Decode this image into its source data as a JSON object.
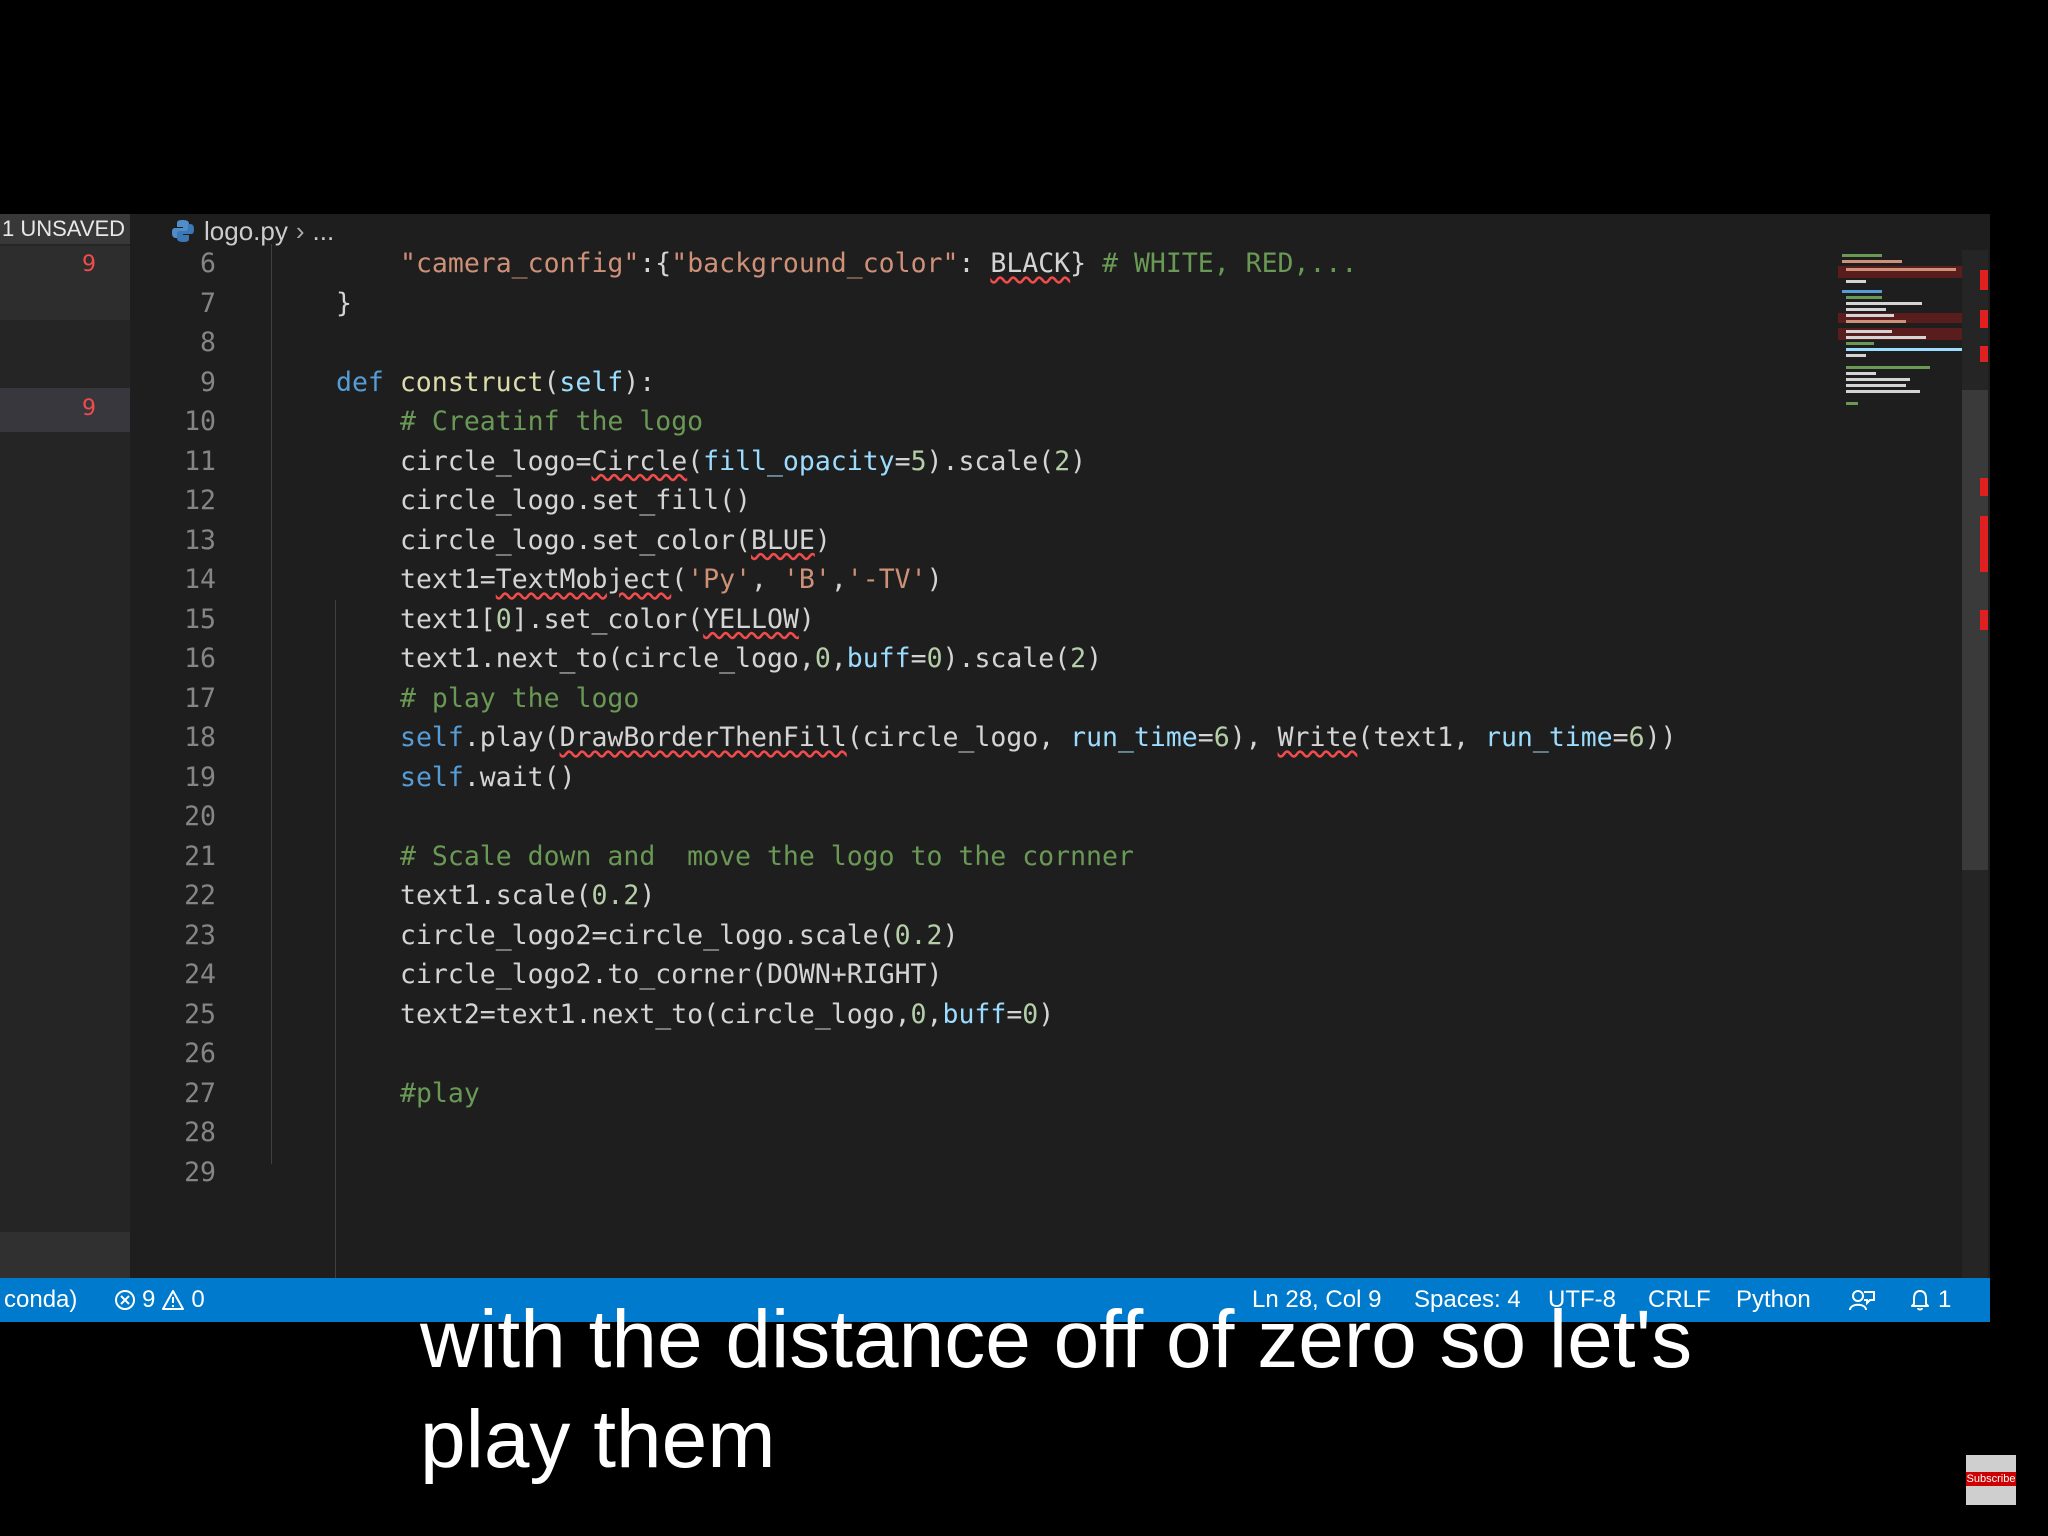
{
  "sidebar": {
    "unsaved_label": "1 UNSAVED",
    "rows": [
      {
        "count": "9"
      },
      {
        "count": "9"
      }
    ]
  },
  "breadcrumb": {
    "file": "logo.py",
    "more": "...",
    "icon": "python-file-icon"
  },
  "code_lines": [
    {
      "number": "6",
      "text": "\"camera_config\":{\"background_color\": BLACK} # WHITE, RED,..."
    },
    {
      "number": "7",
      "text": "}"
    },
    {
      "number": "8",
      "text": ""
    },
    {
      "number": "9",
      "text": "def construct(self):"
    },
    {
      "number": "10",
      "text": "# Creatinf the logo"
    },
    {
      "number": "11",
      "text": "circle_logo=Circle(fill_opacity=5).scale(2)"
    },
    {
      "number": "12",
      "text": "circle_logo.set_fill()"
    },
    {
      "number": "13",
      "text": "circle_logo.set_color(BLUE)"
    },
    {
      "number": "14",
      "text": "text1=TextMobject('Py', 'B','-TV')"
    },
    {
      "number": "15",
      "text": "text1[0].set_color(YELLOW)"
    },
    {
      "number": "16",
      "text": "text1.next_to(circle_logo,0,buff=0).scale(2)"
    },
    {
      "number": "17",
      "text": "# play the logo"
    },
    {
      "number": "18",
      "text": "self.play(DrawBorderThenFill(circle_logo, run_time=6), Write(text1, run_time=6))"
    },
    {
      "number": "19",
      "text": "self.wait()"
    },
    {
      "number": "20",
      "text": ""
    },
    {
      "number": "21",
      "text": "# Scale down and  move the logo to the cornner"
    },
    {
      "number": "22",
      "text": "text1.scale(0.2)"
    },
    {
      "number": "23",
      "text": "circle_logo2=circle_logo.scale(0.2)"
    },
    {
      "number": "24",
      "text": "circle_logo2.to_corner(DOWN+RIGHT)"
    },
    {
      "number": "25",
      "text": "text2=text1.next_to(circle_logo,0,buff=0)"
    },
    {
      "number": "26",
      "text": ""
    },
    {
      "number": "27",
      "text": "#play"
    },
    {
      "number": "28",
      "text": ""
    },
    {
      "number": "29",
      "text": ""
    }
  ],
  "statusbar": {
    "interpreter": "conda)",
    "errors": "9",
    "warnings": "0",
    "position": "Ln 28, Col 9",
    "spaces": "Spaces: 4",
    "encoding": "UTF-8",
    "eol": "CRLF",
    "language": "Python",
    "notifications": "1"
  },
  "caption": {
    "line1": "with the distance off of zero so let's",
    "line2": "play them"
  },
  "subscribe": {
    "label": "Subscribe"
  },
  "colors": {
    "editor_bg": "#1e1e1e",
    "statusbar_bg": "#007acc",
    "keyword": "#569cd6",
    "string": "#ce9178",
    "comment": "#6a9955",
    "error": "#f14c4c"
  }
}
